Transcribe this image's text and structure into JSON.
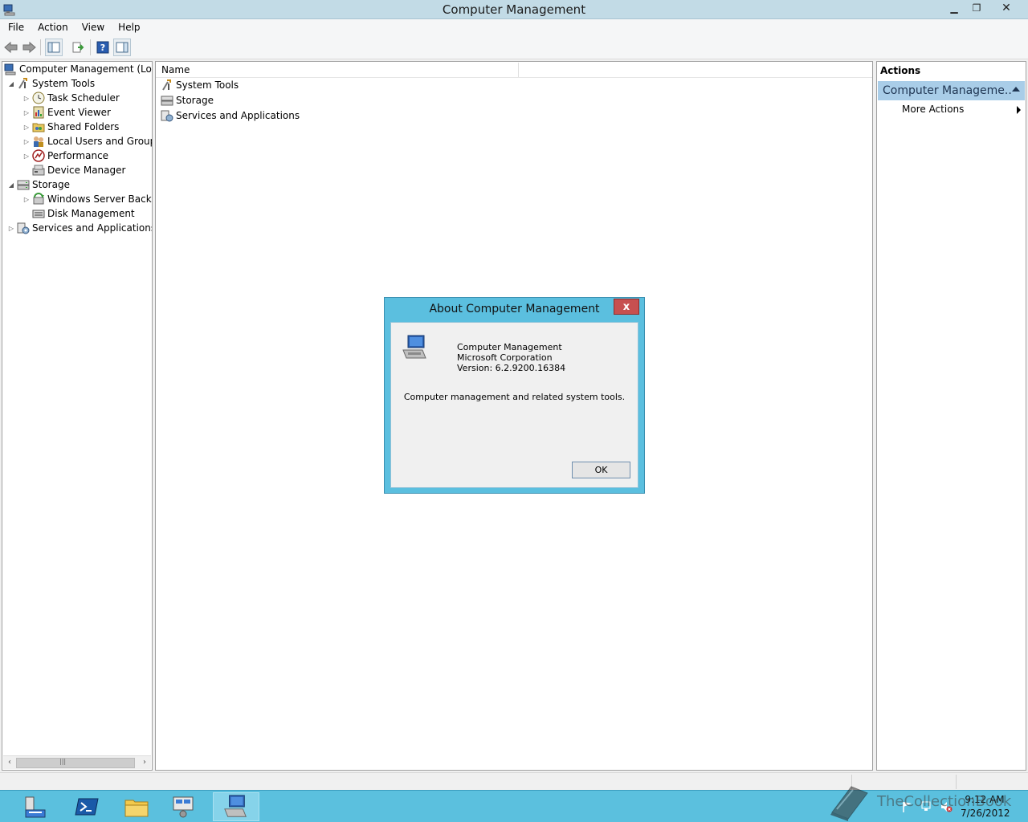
{
  "window": {
    "title": "Computer Management"
  },
  "menu": [
    "File",
    "Action",
    "View",
    "Help"
  ],
  "tree": {
    "root": "Computer Management (Local",
    "items": [
      {
        "label": "System Tools",
        "level": 1,
        "expander": "open"
      },
      {
        "label": "Task Scheduler",
        "level": 2,
        "expander": "closed"
      },
      {
        "label": "Event Viewer",
        "level": 2,
        "expander": "closed"
      },
      {
        "label": "Shared Folders",
        "level": 2,
        "expander": "closed"
      },
      {
        "label": "Local Users and Groups",
        "level": 2,
        "expander": "closed"
      },
      {
        "label": "Performance",
        "level": 2,
        "expander": "closed"
      },
      {
        "label": "Device Manager",
        "level": 2,
        "expander": "none"
      },
      {
        "label": "Storage",
        "level": 1,
        "expander": "open"
      },
      {
        "label": "Windows Server Backup",
        "level": 2,
        "expander": "closed"
      },
      {
        "label": "Disk Management",
        "level": 2,
        "expander": "none"
      },
      {
        "label": "Services and Applications",
        "level": 1,
        "expander": "closed"
      }
    ]
  },
  "list": {
    "column_name": "Name",
    "items": [
      "System Tools",
      "Storage",
      "Services and Applications"
    ]
  },
  "actions": {
    "title": "Actions",
    "group": "Computer Manageme...",
    "more": "More Actions"
  },
  "dialog": {
    "title": "About Computer Management",
    "close": "x",
    "product": "Computer Management",
    "company": "Microsoft Corporation",
    "version": "Version: 6.2.9200.16384",
    "description": "Computer management and related system tools.",
    "ok": "OK"
  },
  "taskbar": {
    "time": "9:12 AM",
    "date": "7/26/2012",
    "watermark": "TheCollectionBook"
  },
  "colors": {
    "titlebar": "#c2dbe6",
    "taskbar": "#5bc0de",
    "dialog_frame": "#5bbfdf",
    "close_red": "#c75050",
    "actions_header": "#a9cde8"
  }
}
